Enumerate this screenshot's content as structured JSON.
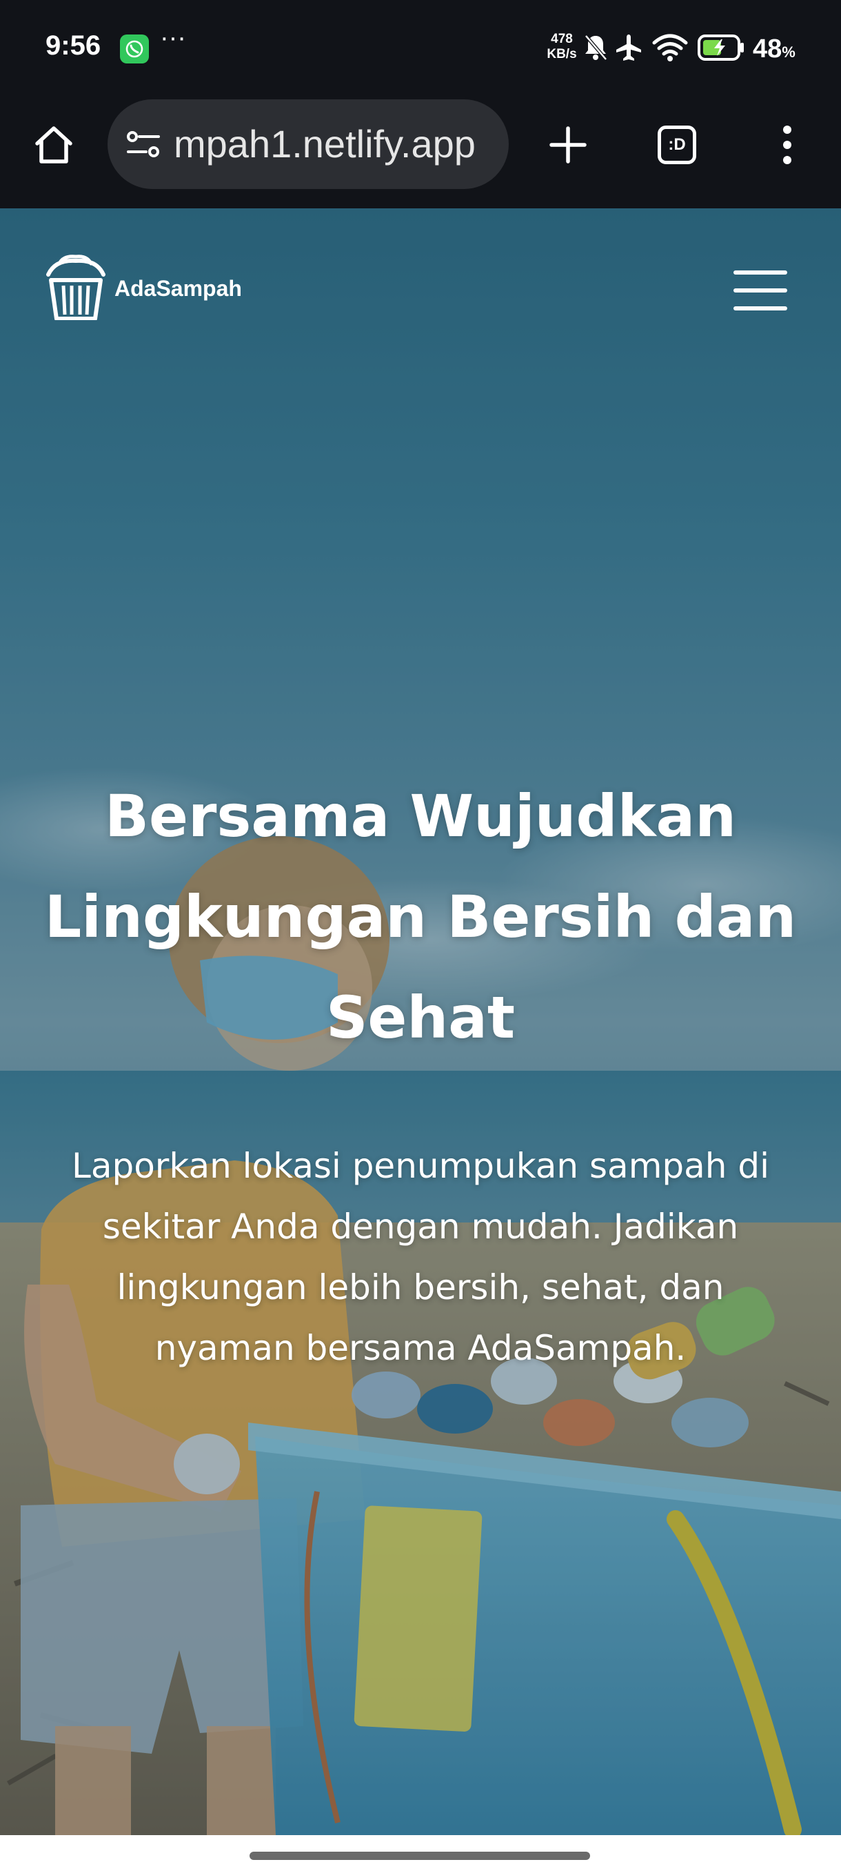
{
  "status_bar": {
    "time": "9:56",
    "speed_value": "478",
    "speed_unit": "KB/s",
    "battery_percent": "48",
    "battery_unit": "%",
    "icons": [
      "whatsapp-icon",
      "more-dots-icon",
      "bell-off-icon",
      "airplane-icon",
      "wifi-icon",
      "battery-charging-icon"
    ]
  },
  "browser": {
    "url": "mpah1.netlify.app",
    "icons": [
      "home-icon",
      "site-settings-icon",
      "new-tab-icon",
      "tab-switcher-icon",
      "overflow-menu-icon"
    ],
    "tab_switcher_label": ":D"
  },
  "navbar": {
    "brand": "AdaSampah",
    "logo_icon": "trash-bin-logo-icon",
    "menu_icon": "hamburger-menu-icon"
  },
  "hero": {
    "title": "Bersama Wujudkan Lingkungan Bersih dan Sehat",
    "subtitle": "Laporkan lokasi penumpukan sampah di sekitar Anda dengan mudah. Jadikan lingkungan lebih bersih, sehat, dan nyaman bersama AdaSampah."
  },
  "colors": {
    "status_bar_bg": "#111318",
    "url_pill_bg": "#2c2e33",
    "hero_sky": "#3f7c94",
    "text": "#ffffff"
  }
}
